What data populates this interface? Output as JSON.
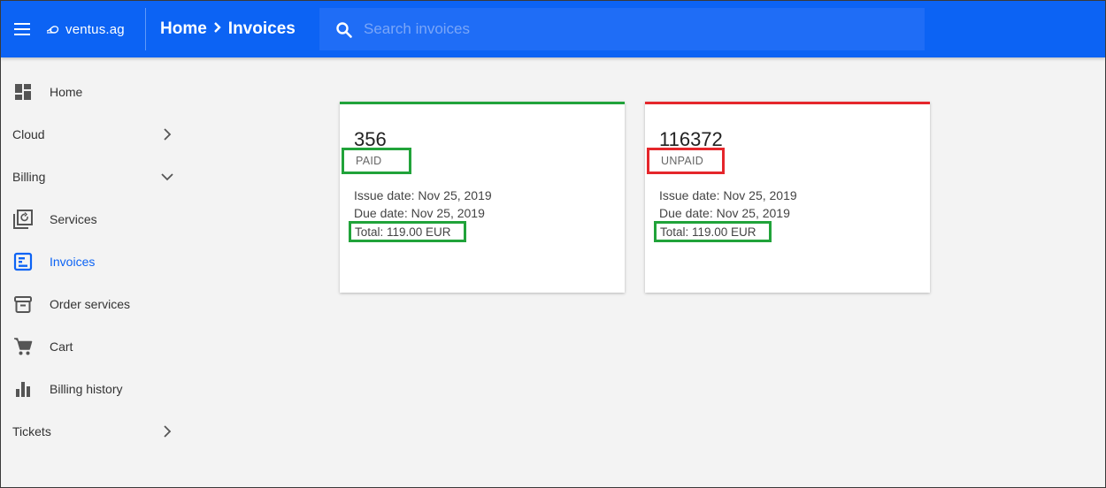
{
  "header": {
    "logo_text": "ventus.ag",
    "breadcrumb": [
      "Home",
      "Invoices"
    ],
    "search_placeholder": "Search invoices",
    "accent_color": "#0c63f4"
  },
  "sidebar": {
    "items": [
      {
        "label": "Home",
        "icon": "dashboard-icon"
      },
      {
        "label": "Cloud",
        "chevron": "chevron-right-icon"
      },
      {
        "label": "Billing",
        "chevron": "chevron-down-icon"
      },
      {
        "label": "Services",
        "icon": "services-icon"
      },
      {
        "label": "Invoices",
        "icon": "invoice-icon",
        "active": true
      },
      {
        "label": "Order services",
        "icon": "archive-box-icon"
      },
      {
        "label": "Cart",
        "icon": "cart-icon"
      },
      {
        "label": "Billing history",
        "icon": "bar-chart-icon"
      },
      {
        "label": "Tickets",
        "chevron": "chevron-right-icon"
      }
    ]
  },
  "invoices": [
    {
      "number": "356",
      "status": "PAID",
      "status_color": "#21a33a",
      "issue_date": "Issue date: Nov 25, 2019",
      "due_date": "Due date: Nov 25, 2019",
      "total": "Total: 119.00 EUR"
    },
    {
      "number": "116372",
      "status": "UNPAID",
      "status_color": "#e5262b",
      "issue_date": "Issue date: Nov 25, 2019",
      "due_date": "Due date: Nov 25, 2019",
      "total": "Total: 119.00 EUR"
    }
  ]
}
